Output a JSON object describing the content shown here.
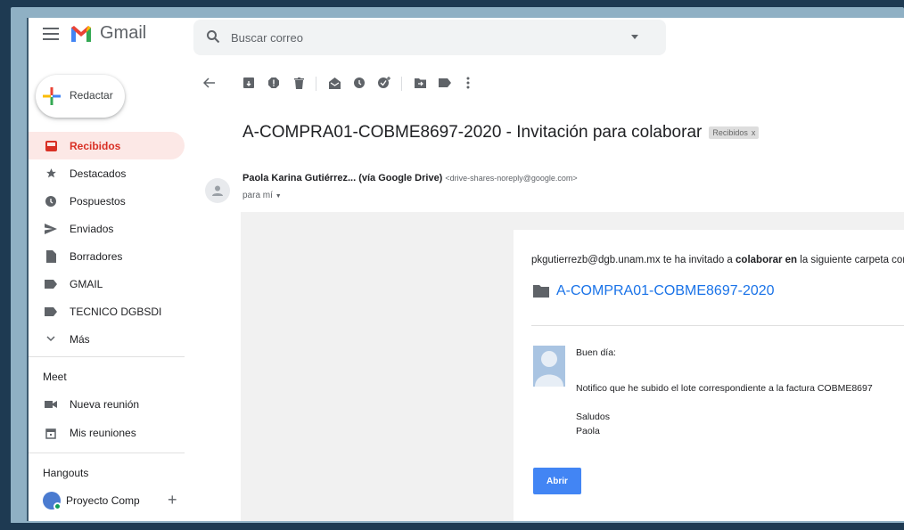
{
  "app": {
    "logo_text": "Gmail",
    "brand_red": "#EA4335",
    "accent_blue": "#1A73E8"
  },
  "search": {
    "placeholder": "Buscar correo"
  },
  "compose": {
    "label": "Redactar"
  },
  "sidebar": {
    "items": [
      {
        "label": "Recibidos",
        "icon": "inbox-icon",
        "active": true
      },
      {
        "label": "Destacados",
        "icon": "star-icon"
      },
      {
        "label": "Pospuestos",
        "icon": "clock-icon"
      },
      {
        "label": "Enviados",
        "icon": "send-icon"
      },
      {
        "label": "Borradores",
        "icon": "draft-icon"
      },
      {
        "label": "GMAIL",
        "icon": "label-icon"
      },
      {
        "label": "TECNICO DGBSDI",
        "icon": "label-icon"
      },
      {
        "label": "Más",
        "icon": "chevron-down-icon"
      }
    ]
  },
  "meet": {
    "title": "Meet",
    "items": [
      {
        "label": "Nueva reunión",
        "icon": "video-icon"
      },
      {
        "label": "Mis reuniones",
        "icon": "calendar-icon"
      }
    ]
  },
  "hangouts": {
    "title": "Hangouts",
    "user": "Proyecto Comp",
    "add_symbol": "+"
  },
  "message": {
    "subject": "A-COMPRA01-COBME8697-2020 - Invitación para colaborar",
    "label_chip": "Recibidos",
    "label_chip_close": "x",
    "sender_name": "Paola Karina Gutiérrez... (vía Google Drive)",
    "sender_email": "<drive-shares-noreply@google.com>",
    "to": "para mí",
    "body": {
      "share_prefix": "pkgutierrezb@dgb.unam.mx te ha invitado a ",
      "share_bold": "colaborar en",
      "share_suffix": " la siguiente carpeta compartida:",
      "folder_name": "A-COMPRA01-COBME8697-2020",
      "greeting": "Buen día:",
      "line1": "Notifico que he subido el lote correspondiente a la factura COBME8697",
      "closing": "Saludos",
      "signature": "Paola",
      "open_button": "Abrir"
    }
  }
}
